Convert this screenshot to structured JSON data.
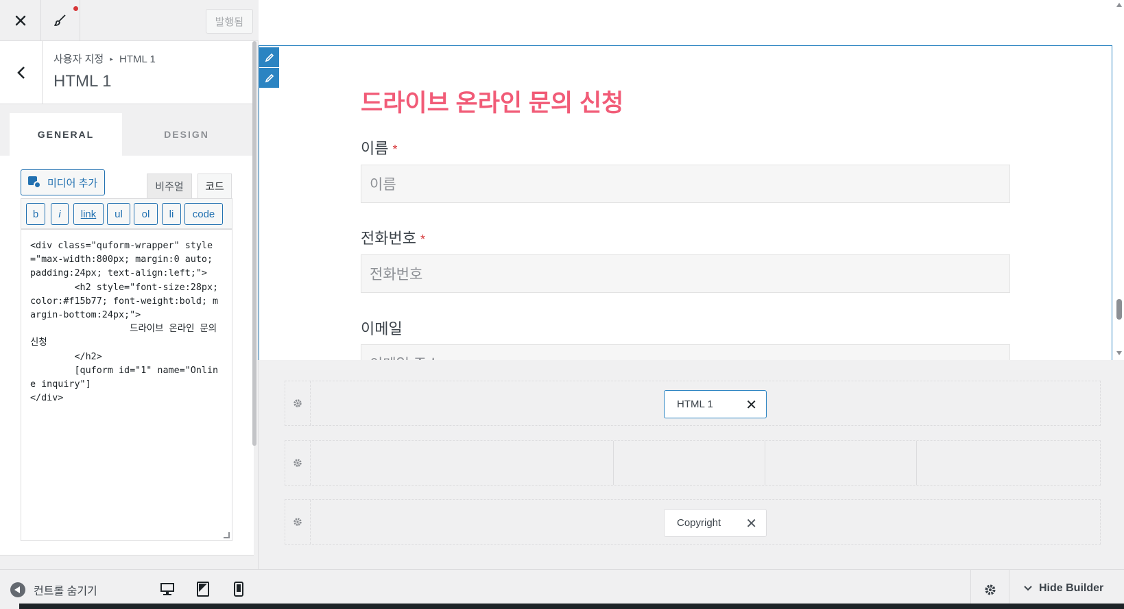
{
  "topbar": {
    "close_icon": "close-icon",
    "brush_icon": "paintbrush-icon",
    "publish_label": "발행됨"
  },
  "section": {
    "breadcrumb_parent": "사용자 지정",
    "breadcrumb_separator": "▸",
    "breadcrumb_child": "HTML 1",
    "title": "HTML 1"
  },
  "tabs": {
    "general": "GENERAL",
    "design": "DESIGN"
  },
  "editor": {
    "media_button": "미디어 추가",
    "visual_tab": "비주얼",
    "code_tab": "코드",
    "quicktags": {
      "b": "b",
      "i": "i",
      "link": "link",
      "ul": "ul",
      "ol": "ol",
      "li": "li",
      "code": "code"
    },
    "content": "<div class=\"quform-wrapper\" style=\"max-width:800px; margin:0 auto; padding:24px; text-align:left;\">\n        <h2 style=\"font-size:28px; color:#f15b77; font-weight:bold; margin-bottom:24px;\">\n                  드라이브 온라인 문의 신청\n        </h2>\n        [quform id=\"1\" name=\"Online inquiry\"]\n</div>"
  },
  "footer": {
    "collapse_label": "컨트롤 숨기기",
    "devices": [
      "desktop-icon",
      "tablet-icon",
      "mobile-icon"
    ]
  },
  "preview": {
    "form_title": "드라이브 온라인 문의 신청",
    "fields": [
      {
        "label": "이름",
        "required_mark": "*",
        "placeholder": "이름"
      },
      {
        "label": "전화번호",
        "required_mark": "*",
        "placeholder": "전화번호"
      },
      {
        "label": "이메일",
        "required_mark": "",
        "placeholder": "이메일 주소"
      }
    ],
    "accent_color": "#f15b77",
    "frame_color": "#2b84c2"
  },
  "builder": {
    "rows": [
      {
        "widget": "HTML 1",
        "active": true
      },
      {
        "widget": null,
        "columns": 4
      },
      {
        "widget": "Copyright",
        "active": false
      }
    ],
    "hide_label": "Hide Builder"
  }
}
